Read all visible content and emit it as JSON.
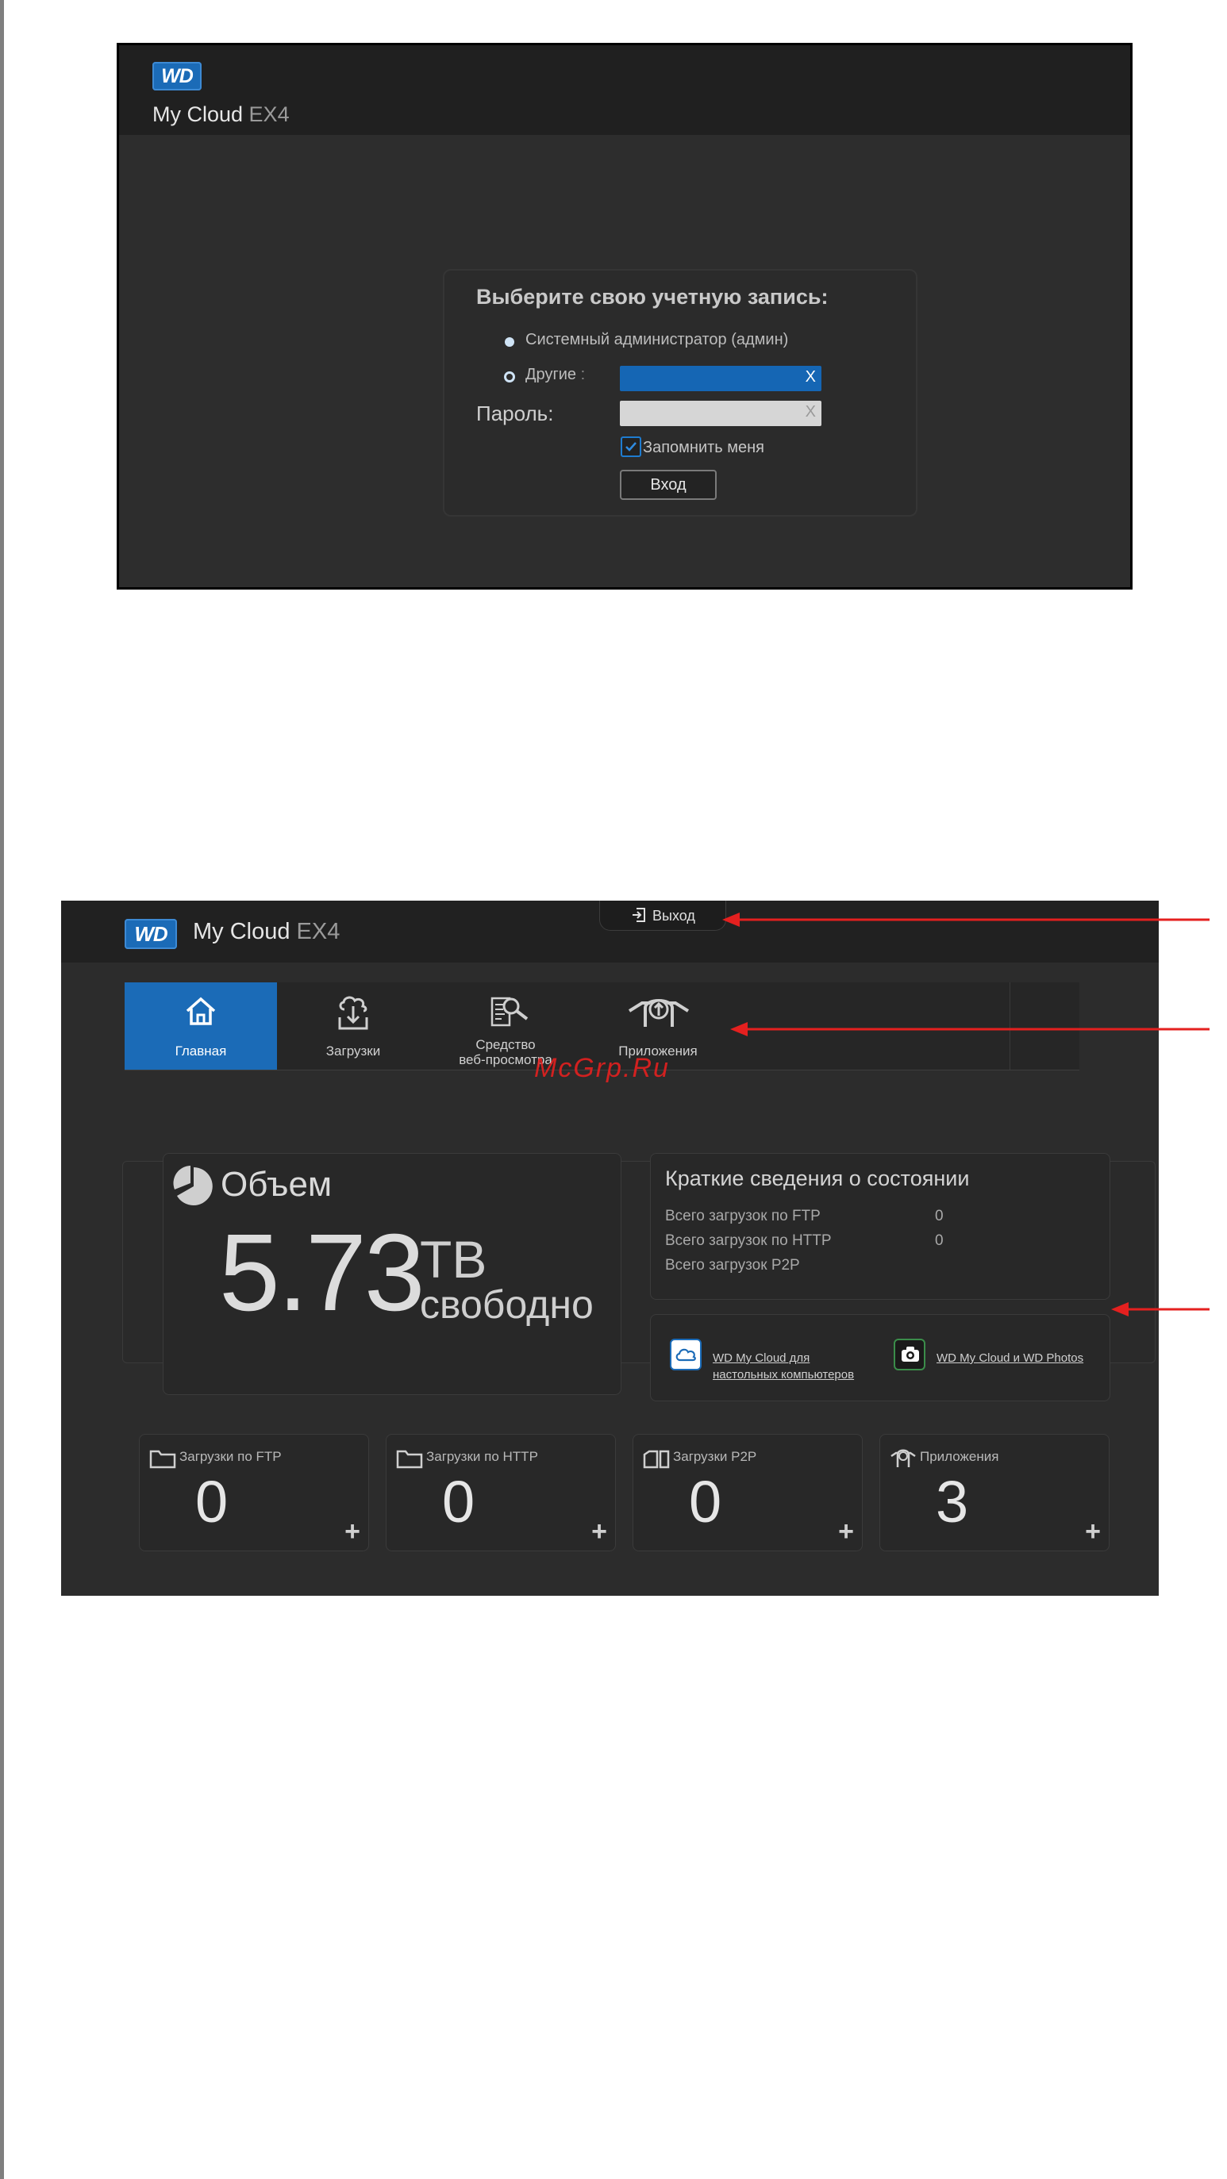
{
  "login": {
    "brand_logo": "WD",
    "product_name": "My Cloud",
    "product_model": " EX4",
    "title": "Выберите свою учетную запись:",
    "option_admin": "Системный администратор (админ)",
    "option_other": "Другие",
    "option_other_colon": " :",
    "password_label": "Пароль:",
    "username_clear": "X",
    "password_clear": "X",
    "remember_label": "Запомнить меня",
    "remember_checked": true,
    "login_button": "Вход"
  },
  "dashboard": {
    "brand_logo": "WD",
    "product_name": "My Cloud",
    "product_model": " EX4",
    "logout_label": "Выход",
    "nav": {
      "home": "Главная",
      "downloads": "Загрузки",
      "web_browser_line1": "Средство",
      "web_browser_line2": "веб-просмотра",
      "apps": "Приложения"
    },
    "watermark": "McGrp.Ru",
    "capacity": {
      "title": "Объем",
      "value": "5.73",
      "unit": "TB",
      "free_label": "свободно"
    },
    "status": {
      "title": "Краткие сведения о состоянии",
      "rows": [
        {
          "label": "Всего загрузок по FTP",
          "value": "0"
        },
        {
          "label": "Всего загрузок по HTTP",
          "value": "0"
        },
        {
          "label": "Всего загрузок P2P",
          "value": ""
        }
      ]
    },
    "links": {
      "desktop_line1": "WD My Cloud для",
      "desktop_line2": "настольных компьютеров",
      "photos": "WD My Cloud и WD Photos"
    },
    "tiles": [
      {
        "label": "Загрузки по FTP",
        "value": "0",
        "plus": "+"
      },
      {
        "label": "Загрузки по HTTP",
        "value": "0",
        "plus": "+"
      },
      {
        "label": "Загрузки P2P",
        "value": "0",
        "plus": "+"
      },
      {
        "label": "Приложения",
        "value": "3",
        "plus": "+"
      }
    ]
  },
  "colors": {
    "accent_blue": "#1b6bb7",
    "annotation_red": "#e4201f",
    "panel_dark": "#2c2c2c"
  }
}
